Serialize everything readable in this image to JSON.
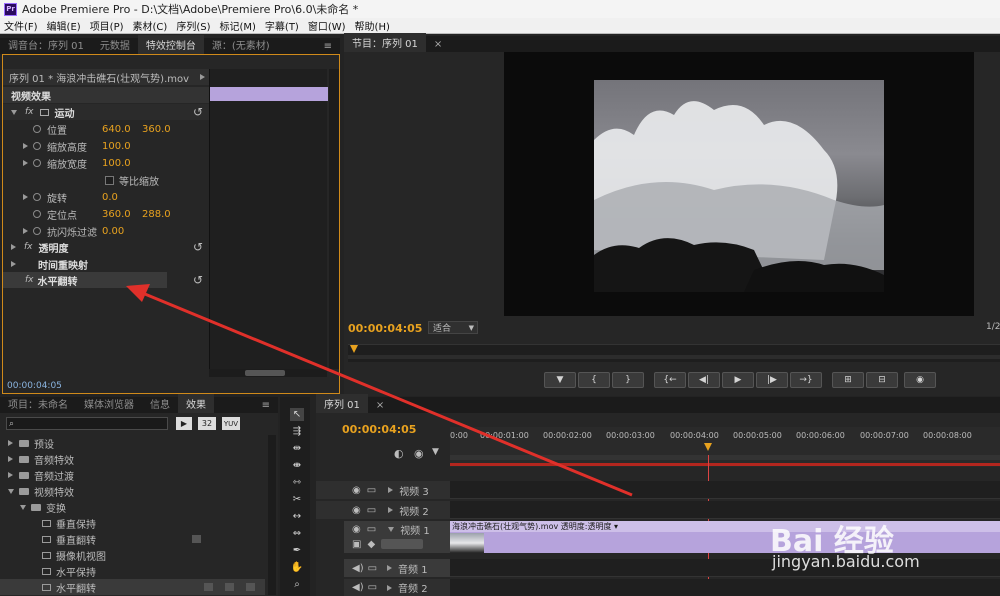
{
  "app": {
    "logo": "Pr",
    "title": "Adobe Premiere Pro - D:\\文档\\Adobe\\Premiere Pro\\6.0\\未命名 *"
  },
  "menu": [
    "文件(F)",
    "编辑(E)",
    "项目(P)",
    "素材(C)",
    "序列(S)",
    "标记(M)",
    "字幕(T)",
    "窗口(W)",
    "帮助(H)"
  ],
  "top_left_tabs": [
    "调音台：序列 01",
    "元数据",
    "特效控制台",
    "源：(无素材)"
  ],
  "effect_controls": {
    "clip_header": "序列 01 * 海浪冲击礁石(壮观气势).mov",
    "video_effects": "视频效果",
    "motion": "运动",
    "position": {
      "label": "位置",
      "x": "640.0",
      "y": "360.0"
    },
    "scale_h": {
      "label": "缩放高度",
      "value": "100.0"
    },
    "scale_w": {
      "label": "缩放宽度",
      "value": "100.0"
    },
    "uniform": "等比缩放",
    "rotation": {
      "label": "旋转",
      "value": "0.0"
    },
    "anchor": {
      "label": "定位点",
      "x": "360.0",
      "y": "288.0"
    },
    "antiflicker": {
      "label": "抗闪烁过滤",
      "value": "0.00"
    },
    "opacity": "透明度",
    "time_remap": "时间重映射",
    "hflip": "水平翻转",
    "timecode": "00:00:04:05"
  },
  "program": {
    "tab": "节目：序列 01",
    "timecode": "00:00:04:05",
    "fit": "适合",
    "fraction": "1/2",
    "buttons": [
      "▼",
      "{",
      "}",
      "{←",
      "◀|",
      "▶",
      "|▶",
      "→}",
      "⊞",
      "⊟",
      "◉"
    ]
  },
  "project_tabs": [
    "项目：未命名",
    "媒体浏览器",
    "信息",
    "效果"
  ],
  "project_icons": [
    "32",
    "YUV"
  ],
  "effects_tree": [
    {
      "label": "预设",
      "level": 0,
      "type": "folder"
    },
    {
      "label": "音频特效",
      "level": 0,
      "type": "folder"
    },
    {
      "label": "音频过渡",
      "level": 0,
      "type": "folder"
    },
    {
      "label": "视频特效",
      "level": 0,
      "type": "folder-open"
    },
    {
      "label": "变换",
      "level": 1,
      "type": "folder-open"
    },
    {
      "label": "垂直保持",
      "level": 2,
      "type": "fx"
    },
    {
      "label": "垂直翻转",
      "level": 2,
      "type": "fx"
    },
    {
      "label": "摄像机视图",
      "level": 2,
      "type": "fx"
    },
    {
      "label": "水平保持",
      "level": 2,
      "type": "fx"
    },
    {
      "label": "水平翻转",
      "level": 2,
      "type": "fx"
    }
  ],
  "timeline": {
    "tab": "序列 01",
    "timecode": "00:00:04:05",
    "ruler": [
      "0:00",
      "00:00:01:00",
      "00:00:02:00",
      "00:00:03:00",
      "00:00:04:00",
      "00:00:05:00",
      "00:00:06:00",
      "00:00:07:00",
      "00:00:08:00"
    ],
    "tracks": [
      {
        "name": "视频 3"
      },
      {
        "name": "视频 2"
      },
      {
        "name": "视频 1"
      },
      {
        "name": "音频 1"
      },
      {
        "name": "音频 2"
      }
    ],
    "clip_label": "海浪冲击礁石(壮观气势).mov  透明度:透明度 ▾"
  },
  "watermark": {
    "brand": "Bai 经验",
    "url": "jingyan.baidu.com"
  },
  "colors": {
    "accent": "#e8a21f",
    "clip": "#b6a3dc",
    "arrow": "#e0302a"
  }
}
